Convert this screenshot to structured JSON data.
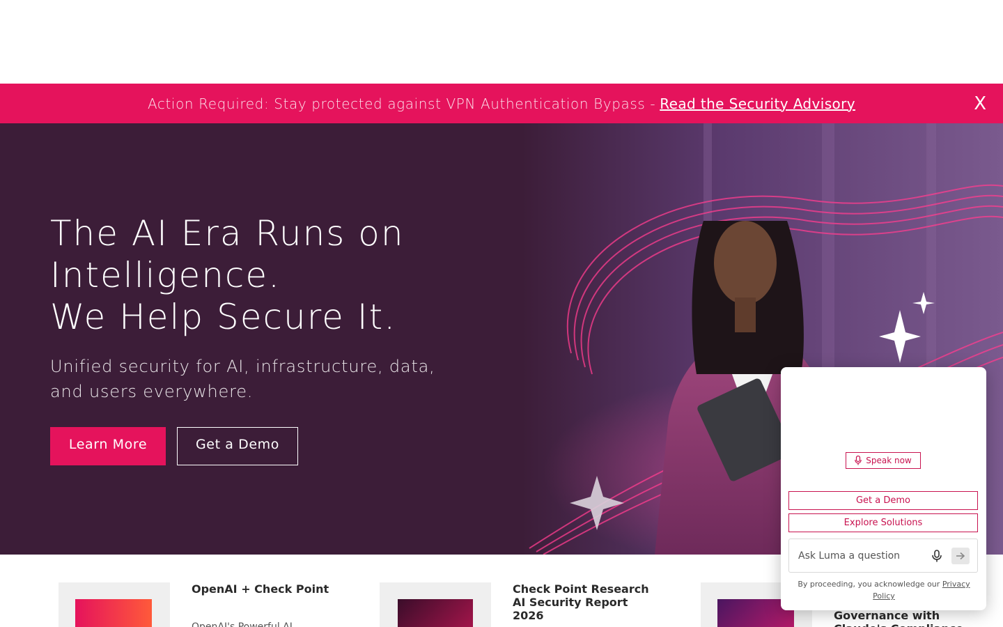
{
  "banner": {
    "text": "Action Required: Stay protected against VPN Authentication Bypass -",
    "link": "Read the Security Advisory",
    "close": "X"
  },
  "hero": {
    "title_line1": "The AI Era Runs on",
    "title_line2": "Intelligence.",
    "title_line3": "We Help Secure It.",
    "subtitle": "Unified security for AI, infrastructure, data, and users everywhere.",
    "primary_button": "Learn More",
    "secondary_button": "Get a Demo"
  },
  "cards": [
    {
      "title": "OpenAI + Check Point",
      "desc": "OpenAI's Powerful AI"
    },
    {
      "title": "Check Point Research AI Security Report 2026",
      "desc": ""
    },
    {
      "title": "Governance with Claude's Compliance",
      "desc": ""
    }
  ],
  "chat": {
    "speak_label": "Speak now",
    "option1": "Get a Demo",
    "option2": "Explore Solutions",
    "input_placeholder": "Ask Luma a question",
    "legal_text": "By proceeding, you acknowledge our",
    "legal_link": "Privacy Policy"
  },
  "colors": {
    "brand_pink": "#e5135c",
    "hero_bg": "#3c1d38",
    "chat_accent": "#c8124f"
  },
  "icons": [
    "close-icon",
    "microphone-icon",
    "send-arrow-icon",
    "sparkle-icon"
  ]
}
